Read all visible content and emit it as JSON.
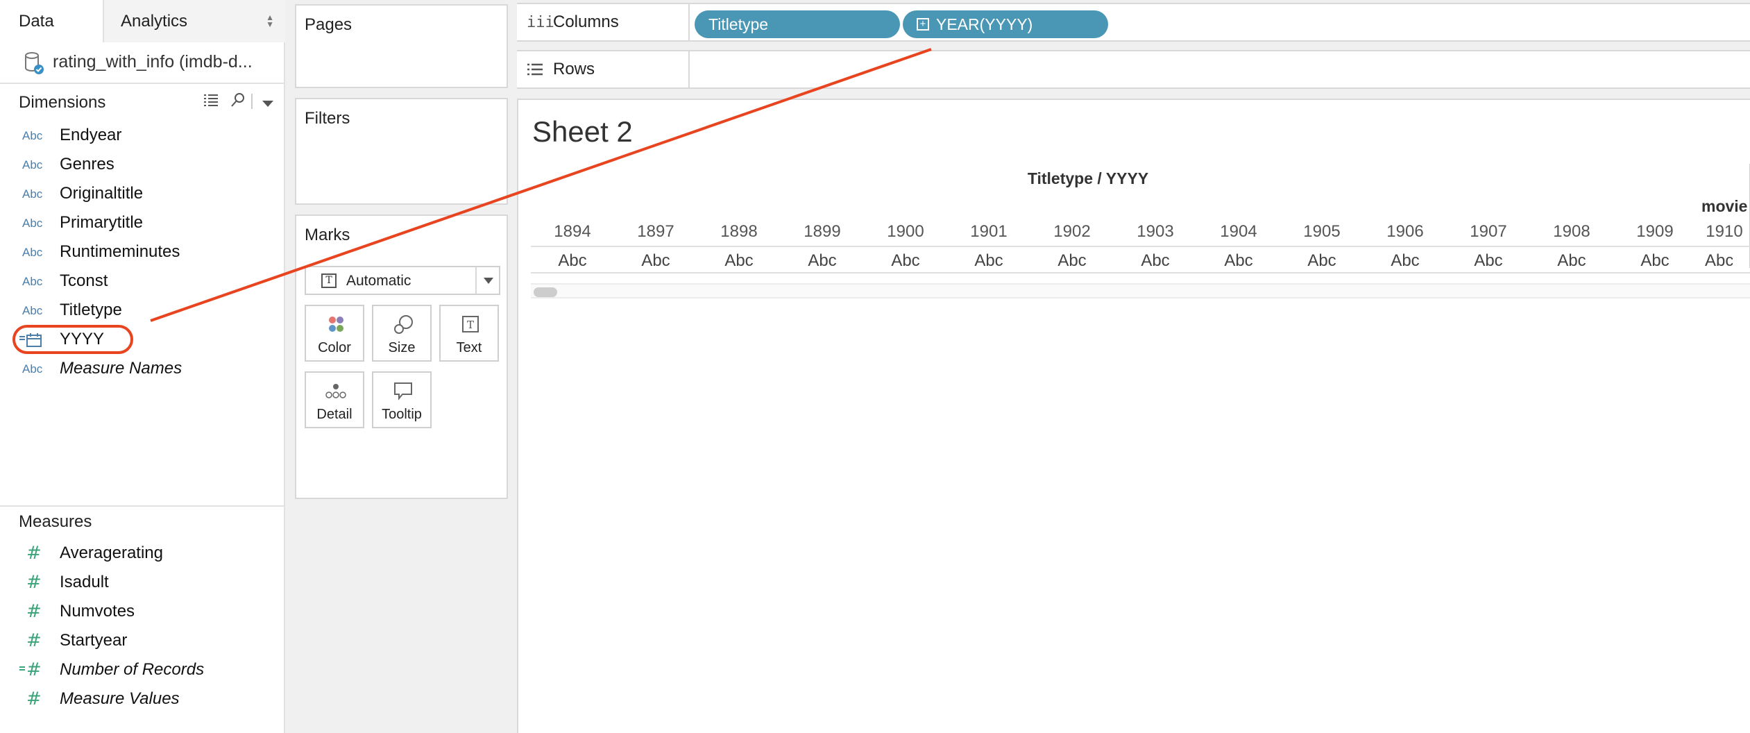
{
  "tabs": {
    "data": "Data",
    "analytics": "Analytics"
  },
  "datasource": {
    "name": "rating_with_info (imdb-d..."
  },
  "dimensions": {
    "heading": "Dimensions",
    "items": [
      {
        "icon": "Abc",
        "label": "Endyear"
      },
      {
        "icon": "Abc",
        "label": "Genres"
      },
      {
        "icon": "Abc",
        "label": "Originaltitle"
      },
      {
        "icon": "Abc",
        "label": "Primarytitle"
      },
      {
        "icon": "Abc",
        "label": "Runtimeminutes"
      },
      {
        "icon": "Abc",
        "label": "Tconst"
      },
      {
        "icon": "Abc",
        "label": "Titletype"
      },
      {
        "icon": "calendar-icon",
        "label": "YYYY"
      },
      {
        "icon": "Abc",
        "label": "Measure Names"
      }
    ]
  },
  "measures": {
    "heading": "Measures",
    "items": [
      {
        "icon": "#",
        "label": "Averagerating"
      },
      {
        "icon": "#",
        "label": "Isadult"
      },
      {
        "icon": "#",
        "label": "Numvotes"
      },
      {
        "icon": "#",
        "label": "Startyear"
      },
      {
        "icon": "#",
        "label": "Number of Records"
      },
      {
        "icon": "#",
        "label": "Measure Values"
      }
    ]
  },
  "shelves": {
    "pages": "Pages",
    "filters": "Filters",
    "marks": "Marks",
    "mark_type": "Automatic",
    "mark_buttons": {
      "color": "Color",
      "size": "Size",
      "text": "Text",
      "detail": "Detail",
      "tooltip": "Tooltip"
    },
    "columns_label": "Columns",
    "rows_label": "Rows",
    "column_pills": [
      "Titletype",
      "YEAR(YYYY)"
    ]
  },
  "viz": {
    "sheet_title": "Sheet 2",
    "header_title": "Titletype / YYYY",
    "group_label": "movie",
    "years": [
      "1894",
      "1897",
      "1898",
      "1899",
      "1900",
      "1901",
      "1902",
      "1903",
      "1904",
      "1905",
      "1906",
      "1907",
      "1908",
      "1909",
      "1910"
    ],
    "cell_text": "Abc"
  },
  "colors": {
    "pill": "#4a97b5",
    "annotation": "#e8441f",
    "dimension_icon": "#4b7ea8",
    "measure_icon": "#3aa37a"
  }
}
